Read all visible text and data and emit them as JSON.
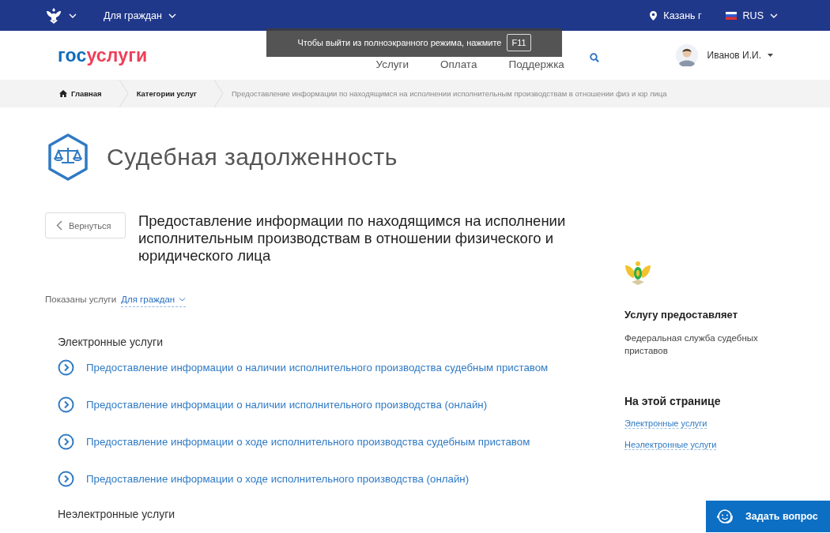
{
  "top_bar": {
    "audience": "Для граждан",
    "location": "Казань г",
    "language": "RUS"
  },
  "header": {
    "logo": [
      "гос",
      "услуги"
    ],
    "nav": [
      "Услуги",
      "Оплата",
      "Поддержка"
    ],
    "user": "Иванов И.И."
  },
  "fullscreen_notice": {
    "text": "Чтобы выйти из полноэкранного режима, нажмите",
    "key": "F11"
  },
  "breadcrumbs": [
    {
      "label": "Главная",
      "kind": "home"
    },
    {
      "label": "Категории услуг",
      "kind": "link"
    },
    {
      "label": "Предоставление информации по находящимся на исполнении исполнительным производствам в отношении физ и юр лица",
      "kind": "current"
    }
  ],
  "page": {
    "title": "Судебная задолженность",
    "back_button": "Вернуться",
    "service_title": "Предоставление информации по находящимся на исполнении исполнительным производствам в отношении физического и юридического лица",
    "filter_label": "Показаны услуги",
    "filter_value": "Для граждан",
    "sections": [
      {
        "heading": "Электронные услуги",
        "items": [
          "Предоставление информации о наличии исполнительного производства судебным приставом",
          "Предоставление информации о наличии исполнительного производства (онлайн)",
          "Предоставление информации о ходе исполнительного производства судебным приставом",
          "Предоставление информации о ходе исполнительного производства (онлайн)"
        ]
      },
      {
        "heading": "Неэлектронные услуги"
      }
    ]
  },
  "sidebar": {
    "provider_heading": "Услугу предоставляет",
    "provider_name": "Федеральная служба судебных приставов",
    "toc_heading": "На этой странице",
    "toc_links": [
      "Электронные услуги",
      "Неэлектронные услуги"
    ]
  },
  "chat_button": "Задать вопрос"
}
